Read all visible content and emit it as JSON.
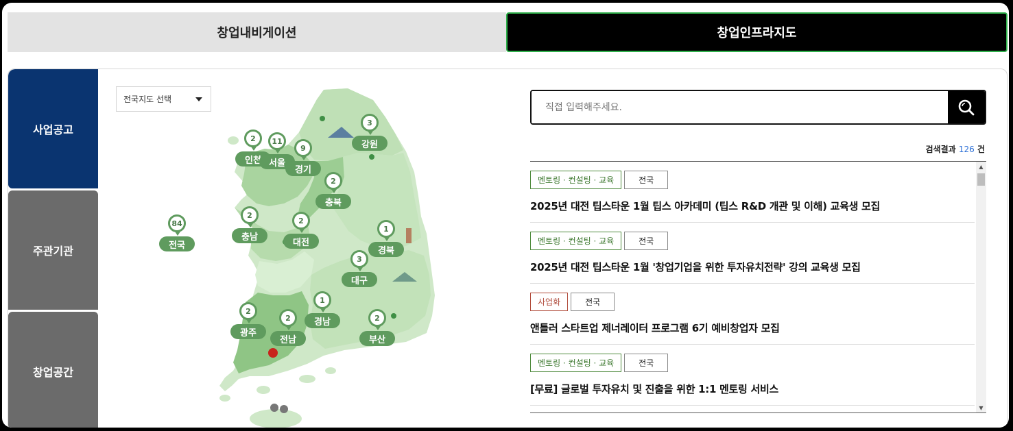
{
  "tabs": [
    {
      "label": "창업내비게이션",
      "active": false
    },
    {
      "label": "창업인프라지도",
      "active": true
    }
  ],
  "side_nav": [
    {
      "label": "사업공고",
      "active": true
    },
    {
      "label": "주관기관",
      "active": false
    },
    {
      "label": "창업공간",
      "active": false
    }
  ],
  "region_select": {
    "selected": "전국지도 선택"
  },
  "regions": [
    {
      "name": "강원",
      "count": "3"
    },
    {
      "name": "인천",
      "count": "2"
    },
    {
      "name": "서울",
      "count": "11"
    },
    {
      "name": "경기",
      "count": "9"
    },
    {
      "name": "충북",
      "count": "2"
    },
    {
      "name": "충남",
      "count": "2"
    },
    {
      "name": "대전",
      "count": "2"
    },
    {
      "name": "경북",
      "count": "1"
    },
    {
      "name": "대구",
      "count": "3"
    },
    {
      "name": "전국",
      "count": "84"
    },
    {
      "name": "광주",
      "count": "2"
    },
    {
      "name": "전남",
      "count": "2"
    },
    {
      "name": "경남",
      "count": "1"
    },
    {
      "name": "부산",
      "count": "2"
    }
  ],
  "search": {
    "placeholder": "직접 입력해주세요.",
    "icon": "search-icon"
  },
  "results": {
    "label_prefix": "검색결과",
    "count": "126",
    "label_suffix": "건"
  },
  "items": [
    {
      "tag": "멘토링 · 컨설팅 · 교육",
      "tag_type": "green",
      "region": "전국",
      "title": "2025년 대전 팁스타운 1월 팁스 아카데미 (팁스 R&D 개관 및 이해) 교육생 모집"
    },
    {
      "tag": "멘토링 · 컨설팅 · 교육",
      "tag_type": "green",
      "region": "전국",
      "title": "2025년 대전 팁스타운 1월 '창업기업을 위한 투자유치전략' 강의 교육생 모집"
    },
    {
      "tag": "사업화",
      "tag_type": "red",
      "region": "전국",
      "title": "앤틀러 스타트업 제너레이터 프로그램 6기 예비창업자 모집"
    },
    {
      "tag": "멘토링 · 컨설팅 · 교육",
      "tag_type": "green",
      "region": "전국",
      "title": "[무료] 글로벌 투자유치 및 진출을 위한 1:1 멘토링 서비스"
    }
  ],
  "colors": {
    "nav_active": "#0a3470",
    "nav_inactive": "#6b6b6b",
    "marker": "#5f9b5e",
    "count_accent": "#2b6fd6",
    "tab_active_border": "#2fb14b"
  }
}
